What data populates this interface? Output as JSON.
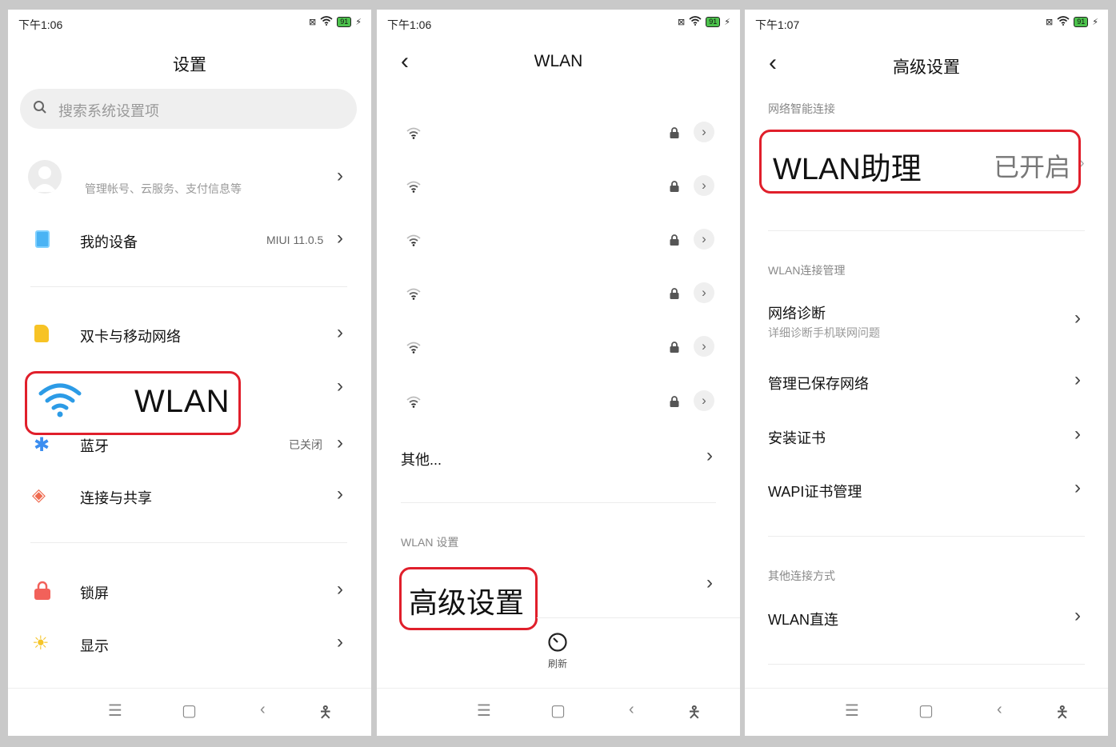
{
  "status": {
    "p1_time": "下午1:06",
    "p2_time": "下午1:06",
    "p3_time": "下午1:07",
    "battery": "91",
    "icons": [
      "sim-x-icon",
      "wifi-icon",
      "battery-icon",
      "charging-icon"
    ]
  },
  "settings": {
    "title": "设置",
    "search_placeholder": "搜索系统设置项",
    "account_sub": "管理帐号、云服务、支付信息等",
    "my_device_label": "我的设备",
    "my_device_value": "MIUI 11.0.5",
    "dual_sim_label": "双卡与移动网络",
    "wlan_label": "WLAN",
    "bluetooth_label": "蓝牙",
    "bluetooth_value": "已关闭",
    "connect_share_label": "连接与共享",
    "lock_screen_label": "锁屏",
    "display_label": "显示"
  },
  "wlan": {
    "title": "WLAN",
    "networks_count_note": "",
    "other_label": "其他...",
    "section_label": "WLAN 设置",
    "advanced_label": "高级设置",
    "refresh_label": "刷新"
  },
  "advanced": {
    "title": "高级设置",
    "section_smart": "网络智能连接",
    "assistant_label": "WLAN助理",
    "assistant_value": "已开启",
    "section_manage": "WLAN连接管理",
    "diagnose_label": "网络诊断",
    "diagnose_sub": "详细诊断手机联网问题",
    "saved_label": "管理已保存网络",
    "cert_label": "安装证书",
    "wapi_label": "WAPI证书管理",
    "section_other": "其他连接方式",
    "direct_label": "WLAN直连"
  },
  "colors": {
    "highlight": "#e01f2b",
    "wifi_blue": "#2c9be6",
    "device_blue": "#4ab3f4",
    "sim_yellow": "#f7c325",
    "bluetooth_blue": "#3c8ef0",
    "share_red": "#ef6a4f",
    "lock_red": "#f2615a",
    "display_yellow": "#f5c52a"
  }
}
